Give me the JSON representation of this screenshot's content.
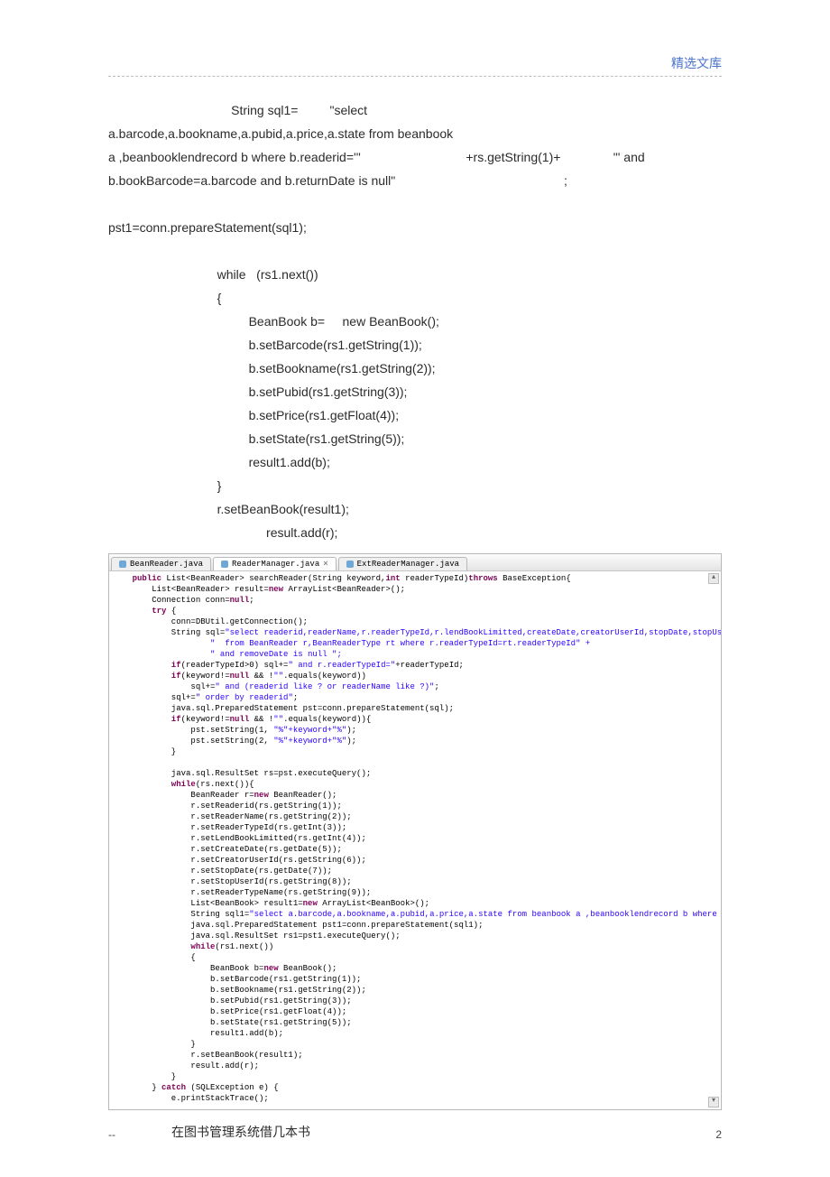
{
  "header": {
    "right_label": "精选文库"
  },
  "body_text": {
    "l1a": "                                   String sql1=",
    "l1b": "         \"select",
    "l2": "a.barcode,a.bookname,a.pubid,a.price,a.state from beanbook",
    "l3a": "a ,beanbooklendrecord b where b.readerid='\"",
    "l3b": "                              +rs.getString(1)+",
    "l3c": "               \"' and",
    "l4a": "b.bookBarcode=a.barcode and b.returnDate is null\"",
    "l4b": "                                                ;",
    "l5": "pst1=conn.prepareStatement(sql1);",
    "l6": "                               while   (rs1.next())",
    "l7": "                               {",
    "l8": "                                        BeanBook b=     new BeanBook();",
    "l9": "                                        b.setBarcode(rs1.getString(1));",
    "l10": "                                        b.setBookname(rs1.getString(2));",
    "l11": "                                        b.setPubid(rs1.getString(3));",
    "l12": "                                        b.setPrice(rs1.getFloat(4));",
    "l13": "                                        b.setState(rs1.getString(5));",
    "l14": "                                        result1.add(b);",
    "l15": "                               }",
    "l16": "                               r.setBeanBook(result1);",
    "l17": "                                             result.add(r);"
  },
  "ide": {
    "tabs": [
      {
        "label": "BeanReader.java",
        "active": false
      },
      {
        "label": "ReaderManager.java",
        "active": true
      },
      {
        "label": "ExtReaderManager.java",
        "active": false
      }
    ],
    "code": {
      "l01_kw": "    public ",
      "l01_b": "List<BeanReader> searchReader(String keyword,",
      "l01_kw2": "int ",
      "l01_c": "readerTypeId)",
      "l01_kw3": "throws ",
      "l01_d": "BaseException{",
      "l02": "        List<BeanReader> result=",
      "l02_kw": "new ",
      "l02_b": "ArrayList<BeanReader>();",
      "l03": "        Connection conn=",
      "l03_kw": "null",
      "l03_b": ";",
      "l04_kw": "        try ",
      "l04_b": "{",
      "l05": "            conn=DBUtil.getConnection();",
      "l06": "            String sql=",
      "l06_s": "\"select readerid,readerName,r.readerTypeId,r.lendBookLimitted,createDate,creatorUserId,stopDate,stopUserId,rt.readerTypeN",
      "l07_s": "                    \"  from BeanReader r,BeanReaderType rt where r.readerTypeId=rt.readerTypeId\" +",
      "l08_s": "                    \" and removeDate is null \";",
      "l09_kw": "            if",
      "l09_b": "(readerTypeId>0) sql+=",
      "l09_s": "\" and r.readerTypeId=\"",
      "l09_c": "+readerTypeId;",
      "l10_kw": "            if",
      "l10_b": "(keyword!=",
      "l10_kw2": "null ",
      "l10_c": "&& !",
      "l10_s": "\"\"",
      "l10_d": ".equals(keyword))",
      "l11": "                sql+=",
      "l11_s": "\" and (readerid like ? or readerName like ?)\"",
      "l11_b": ";",
      "l12": "            sql+=",
      "l12_s": "\" order by readerid\"",
      "l12_b": ";",
      "l13": "            java.sql.PreparedStatement pst=conn.prepareStatement(sql);",
      "l14_kw": "            if",
      "l14_b": "(keyword!=",
      "l14_kw2": "null ",
      "l14_c": "&& !",
      "l14_s": "\"\"",
      "l14_d": ".equals(keyword)){",
      "l15": "                pst.setString(1, ",
      "l15_s": "\"%\"+keyword+\"%\"",
      "l15_b": ");",
      "l16": "                pst.setString(2, ",
      "l16_s": "\"%\"+keyword+\"%\"",
      "l16_b": ");",
      "l17": "            }",
      "l18": "",
      "l19": "            java.sql.ResultSet rs=pst.executeQuery();",
      "l20_kw": "            while",
      "l20_b": "(rs.next()){",
      "l21": "                BeanReader r=",
      "l21_kw": "new ",
      "l21_b": "BeanReader();",
      "l22": "                r.setReaderid(rs.getString(1));",
      "l23": "                r.setReaderName(rs.getString(2));",
      "l24": "                r.setReaderTypeId(rs.getInt(3));",
      "l25": "                r.setLendBookLimitted(rs.getInt(4));",
      "l26": "                r.setCreateDate(rs.getDate(5));",
      "l27": "                r.setCreatorUserId(rs.getString(6));",
      "l28": "                r.setStopDate(rs.getDate(7));",
      "l29": "                r.setStopUserId(rs.getString(8));",
      "l30": "                r.setReaderTypeName(rs.getString(9));",
      "l31": "                List<BeanBook> result1=",
      "l31_kw": "new ",
      "l31_b": "ArrayList<BeanBook>();",
      "l32": "                String sql1=",
      "l32_s": "\"select a.barcode,a.bookname,a.pubid,a.price,a.state from beanbook a ,beanbooklendrecord b where b.readerid='\"",
      "l32_b": "+rs.ge",
      "l33": "                java.sql.PreparedStatement pst1=conn.prepareStatement(sql1);",
      "l34": "                java.sql.ResultSet rs1=pst1.executeQuery();",
      "l35_kw": "                while",
      "l35_b": "(rs1.next())",
      "l36": "                {",
      "l37": "                    BeanBook b=",
      "l37_kw": "new ",
      "l37_b": "BeanBook();",
      "l38": "                    b.setBarcode(rs1.getString(1));",
      "l39": "                    b.setBookname(rs1.getString(2));",
      "l40": "                    b.setPubid(rs1.getString(3));",
      "l41": "                    b.setPrice(rs1.getFloat(4));",
      "l42": "                    b.setState(rs1.getString(5));",
      "l43": "                    result1.add(b);",
      "l44": "                }",
      "l45": "                r.setBeanBook(result1);",
      "l46": "                result.add(r);",
      "l47": "            }",
      "l48": "        } ",
      "l48_kw": "catch ",
      "l48_b": "(SQLException e) {",
      "l49": "            e.printStackTrace();"
    }
  },
  "caption": "在图书管理系统借几本书",
  "footer": {
    "left": "--",
    "right": "2"
  }
}
